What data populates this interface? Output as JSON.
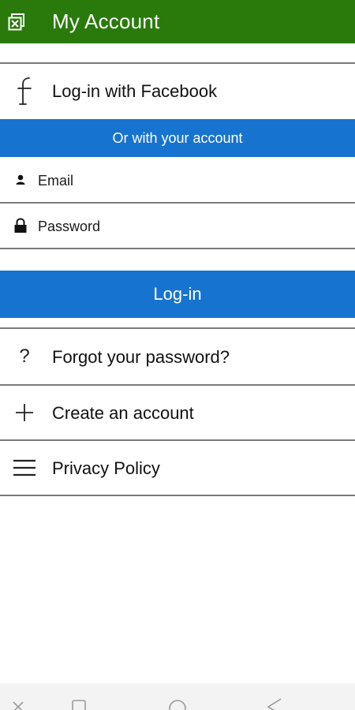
{
  "app_bar": {
    "title": "My Account",
    "icon": "app-logo-icon",
    "background": "#2a7a0b"
  },
  "facebook_login": {
    "label": "Log-in with Facebook",
    "icon": "facebook-icon"
  },
  "account_banner": {
    "text": "Or with your account",
    "background": "#1773d0"
  },
  "form": {
    "email": {
      "placeholder": "Email",
      "value": "",
      "icon": "user-icon"
    },
    "password": {
      "placeholder": "Password",
      "value": "",
      "icon": "lock-icon"
    }
  },
  "login_button": {
    "label": "Log-in",
    "background": "#1773d0"
  },
  "menu": [
    {
      "label": "Forgot your password?",
      "icon": "question-icon"
    },
    {
      "label": "Create an account",
      "icon": "plus-icon"
    },
    {
      "label": "Privacy Policy",
      "icon": "menu-icon"
    }
  ],
  "system_nav": {
    "buttons": [
      "close-icon",
      "recent-apps-icon",
      "home-icon",
      "back-icon"
    ]
  }
}
